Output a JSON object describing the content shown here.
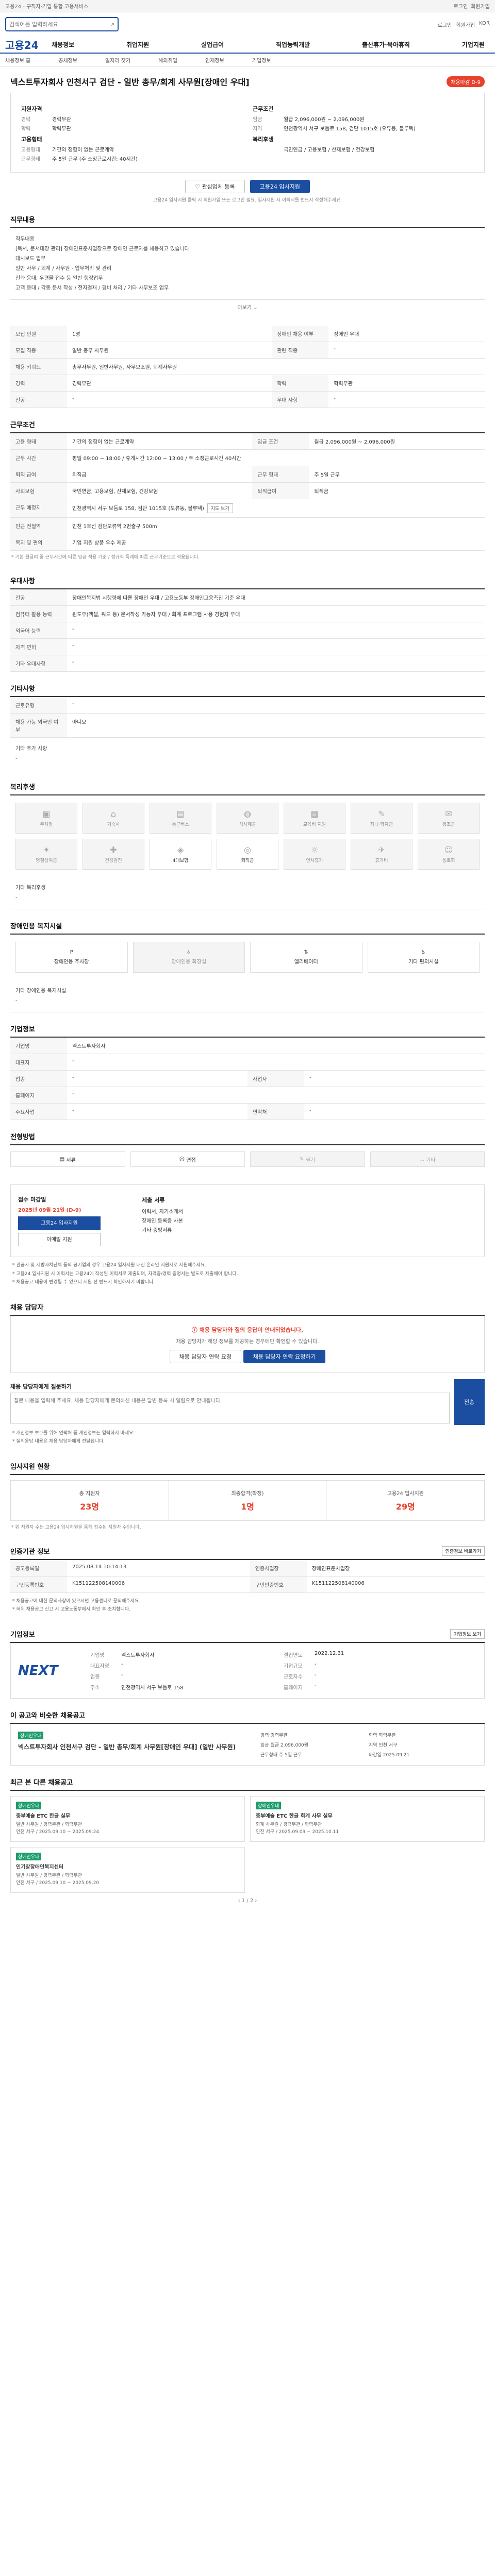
{
  "topbar": {
    "notice": "고용24 - 구직자·기업 통합 고용서비스",
    "links": [
      "로그인",
      "회원가입"
    ]
  },
  "search": {
    "placeholder": "검색어를 입력하세요",
    "util": [
      "로그인",
      "회원가입",
      "KOR"
    ]
  },
  "gnb": {
    "brand": "고용24",
    "menu": [
      "채용정보",
      "취업지원",
      "실업급여",
      "직업능력개발",
      "출산휴가·육아휴직",
      "기업지원"
    ]
  },
  "subnav": [
    "채용정보 홈",
    "공채정보",
    "일자리 찾기",
    "해외취업",
    "인재정보",
    "기업정보"
  ],
  "job": {
    "title": "넥스트투자회사 인천서구 검단 - 일반 총무/회계 사무원[장애인 우대]",
    "badge": "채용마감 D-9",
    "summary": {
      "left_title": "지원자격",
      "left": [
        [
          "경력",
          "경력무관"
        ],
        [
          "학력",
          "학력무관"
        ]
      ],
      "left2_title": "고용형태",
      "left2": [
        [
          "고용형태",
          "기간의 정함이 없는 근로계약"
        ],
        [
          "근무형태",
          "주 5일 근무 (주 소정근로시간: 40시간)"
        ]
      ],
      "right_title": "근무조건",
      "right": [
        [
          "임금",
          "월급 2,096,000원 ~ 2,096,000원"
        ],
        [
          "지역",
          "인천광역시 서구 보듬로 158, 검단 1015호 (오류동, 블루텍)"
        ]
      ],
      "right2_title": "복리후생",
      "right2": [
        [
          "",
          "국민연금 / 고용보험 / 산재보험 / 건강보험"
        ]
      ]
    },
    "buttons": {
      "save": "관심업체 등록",
      "apply": "고용24 입사지원"
    },
    "note": "고용24 입사지원 클릭 시 회원가입 또는 로그인 필요. 입사지원 시 이력서를 반드시 작성해주세요."
  },
  "duties": {
    "title": "직무내용",
    "lines": [
      "직무내용",
      "[독서, 문서대장 관리] 장애인표준사업장으로 장애인 근로자를 채용하고 있습니다.",
      "대시보드 업무",
      "일반 사무 / 회계 / 사무원 - 업무처리 및 관리",
      "전화 응대, 우편물 접수 등 일반 행정업무",
      "고객 응대 / 각종 문서 작성 / 전자결재 / 경비 처리 / 기타 사무보조 업무"
    ],
    "more": "더보기"
  },
  "recruit_table": {
    "rows": [
      [
        "모집 인원",
        "1명",
        "장애인 채용 여부",
        "장애인 우대"
      ],
      [
        "모집 직종",
        "일반 총무 사무원",
        "관련 직종",
        "-"
      ],
      [
        "채용 키워드",
        "총무사무원, 일반사무원, 사무보조원, 회계사무원",
        "",
        ""
      ],
      [
        "경력",
        "경력무관",
        "학력",
        "학력무관"
      ],
      [
        "전공",
        "-",
        "우대 사항",
        "-"
      ]
    ]
  },
  "conditions": {
    "title": "근무조건",
    "rows": [
      [
        "고용 형태",
        "기간의 정함이 없는 근로계약",
        "임금 조건",
        "월급 2,096,000원 ~ 2,096,000원"
      ],
      [
        "근무 시간",
        "평일 09:00 ~ 18:00 / 휴게시간 12:00 ~ 13:00 / 주 소정근로시간 40시간",
        "",
        ""
      ],
      [
        "퇴직 급여",
        "퇴직금",
        "근무 형태",
        "주 5일 근무"
      ],
      [
        "사회보험",
        "국민연금, 고용보험, 산재보험, 건강보험",
        "퇴직급여",
        "퇴직금"
      ],
      [
        "근무 예정지",
        "인천광역시 서구 보듬로 158, 검단 1015호 (오류동, 블루텍)",
        "",
        ""
      ],
      [
        "인근 전철역",
        "인천 1호선 검단오류역 2번출구 500m",
        "",
        ""
      ],
      [
        "복지 및 편의",
        "기업 지원 상품 우수 제공",
        "",
        ""
      ]
    ],
    "map_btn": "지도 보기",
    "note": "* 기본 월급여 중 근무시간에 따른 임금 적용 기준 / 정규직 특례에 따른 근무기준으로 적용됩니다."
  },
  "company": {
    "title": "우대사항",
    "rows": [
      [
        "전공",
        "장애인복지법 시행령에 따른 장애인 우대 / 고용노동부 장애인고용촉진 기준 우대"
      ],
      [
        "컴퓨터 활용 능력",
        "윈도우(엑셀, 워드 등) 문서작성 가능자 우대 / 회계 프로그램 사용 경험자 우대"
      ],
      [
        "외국어 능력",
        "-"
      ],
      [
        "자격 면허",
        "-"
      ],
      [
        "기타 우대사항",
        "-"
      ]
    ]
  },
  "extra": {
    "title": "기타사항",
    "rows": [
      [
        "근로유형",
        "-"
      ],
      [
        "채용 가능 외국인 여부",
        "아니요"
      ]
    ],
    "sub": "기타 추가 사항",
    "sub_text": "-"
  },
  "welfare": {
    "title": "복리후생",
    "items": [
      "주차장",
      "기숙사",
      "통근버스",
      "식사제공",
      "교육비 지원",
      "자녀 학자금",
      "경조금",
      "명절상여금",
      "건강검진",
      "4대보험",
      "퇴직금",
      "연차휴가",
      "휴가비",
      "동호회"
    ],
    "note": "기타 복리후생",
    "note_val": "-"
  },
  "disability": {
    "title": "장애인용 복지시설",
    "tabs": [
      "장애인용 주차장",
      "장애인용 화장실",
      "엘리베이터",
      "기타 편의시설"
    ],
    "note": "기타 장애인용 복지시설",
    "note_val": "-"
  },
  "corp_table": {
    "title": "기업정보",
    "rows": [
      [
        "기업명",
        "넥스트투자회사",
        "",
        ""
      ],
      [
        "대표자",
        "-",
        "",
        ""
      ],
      [
        "업종",
        "-",
        "사업자",
        "-"
      ],
      [
        "홈페이지",
        "-",
        "",
        ""
      ],
      [
        "주요사업",
        "-",
        "연락처",
        "-"
      ]
    ]
  },
  "method": {
    "title": "전형방법",
    "items": [
      "서류",
      "면접",
      "필기",
      "기타"
    ]
  },
  "apply": {
    "title_left": "접수 마감일",
    "deadline": "2025년 09월 21일 (D-9)",
    "btn_apply": "고용24 입사지원",
    "btn_email": "이메일 지원",
    "right_title": "제출 서류",
    "right": [
      "이력서, 자기소개서",
      "장애인 등록증 사본",
      "기타 증빙서류"
    ],
    "notes": [
      "* 관공서 및 지방자치단체 등의 공기업의 경우 고용24 입사지원 대신 온라인 지원서로 지원해주세요.",
      "* 고용24 입사지원 시 이력서는 고용24에 작성된 이력서로 제출되며, 자격증/경력 증명서는 별도로 제출해야 합니다.",
      "* 채용공고 내용이 변경될 수 있으니 지원 전 반드시 확인하시기 바랍니다."
    ]
  },
  "qna": {
    "title": "채용 담당자",
    "alert": "채용 담당자와 질의 응답이 안내되었습니다.",
    "desc": "채용 담당자가 해당 정보를 제공하는 경우에만 확인할 수 있습니다.",
    "btn1": "채용 담당자 연락 요청",
    "btn2": "채용 담당자 연락 요청하기",
    "q_label": "채용 담당자에게 질문하기",
    "q_placeholder": "질문 내용을 입력해 주세요. 채용 담당자에게 문의하신 내용은 답변 등록 시 알림으로 안내됩니다.",
    "send": "전송",
    "notes": [
      "* 개인정보 보호를 위해 연락처 등 개인정보는 입력하지 마세요.",
      "* 질의응답 내용은 채용 담당자에게 전달됩니다."
    ]
  },
  "stats": {
    "title": "입사지원 현황",
    "items": [
      [
        "총 지원자",
        "23명"
      ],
      [
        "최종합격(확정)",
        "1명"
      ],
      [
        "고용24 입사지원",
        "29명"
      ]
    ],
    "note": "* 위 지원자 수는 고용24 입사지원을 통해 접수된 지원자 수입니다."
  },
  "info": {
    "title": "인증기관 정보",
    "rows": [
      [
        "공고등록일",
        "2025.08.14 10:14:13",
        "인증사업장",
        "장애인표준사업장"
      ],
      [
        "구인등록번호",
        "K151122508140006",
        "구인인증번호",
        "K151122508140006"
      ]
    ],
    "btn": "인증정보 바로가기",
    "notes": [
      "* 채용공고에 대한 문의사항이 있으시면 고용센터로 문의해주세요.",
      "* 허위 채용공고 신고 시 고용노동부에서 확인 후 조치합니다."
    ]
  },
  "corp": {
    "title": "기업정보",
    "logo": "NEXT",
    "info": [
      [
        "기업명",
        "넥스트투자회사"
      ],
      [
        "설립연도",
        "2022.12.31"
      ],
      [
        "대표자명",
        "-"
      ],
      [
        "기업규모",
        "-"
      ],
      [
        "업종",
        "-"
      ],
      [
        "근로자수",
        "-"
      ],
      [
        "주소",
        "인천광역시 서구 보듬로 158"
      ],
      [
        "홈페이지",
        "-"
      ]
    ],
    "btn": "기업정보 보기"
  },
  "rec": {
    "title": "이 공고와 비슷한 채용공고",
    "tag": "장애인우대",
    "job_title": "넥스트투자회사 인천서구 검단 - 일반 총무/회계 사무원[장애인 우대] (일반 사무원)",
    "right": [
      [
        "경력",
        "경력무관"
      ],
      [
        "학력",
        "학력무관"
      ],
      [
        "임금",
        "월급 2,096,000원"
      ],
      [
        "지역",
        "인천 서구"
      ],
      [
        "근무형태",
        "주 5일 근무"
      ],
      [
        "마감일",
        "2025.09.21"
      ]
    ]
  },
  "recent": {
    "title": "최근 본 다른 채용공고",
    "cards": [
      {
        "tag": "장애인우대",
        "title": "중부예술 ETC 한글 실무",
        "desc": "일반 사무원 / 경력무관 / 학력무관\n인천 서구 / 2025.09.10 ~ 2025.09.24"
      },
      {
        "tag": "장애인우대",
        "title": "중부예술 ETC 한글 회계 사무 실무",
        "desc": "회계 사무원 / 경력무관 / 학력무관\n인천 서구 / 2025.09.09 ~ 2025.10.11"
      },
      {
        "tag": "장애인우대",
        "title": "인기창장애인복지센터",
        "desc": "일반 사무원 / 경력무관 / 학력무관\n인천 서구 / 2025.09.10 ~ 2025.09.20"
      }
    ],
    "pager": "1 / 2"
  }
}
